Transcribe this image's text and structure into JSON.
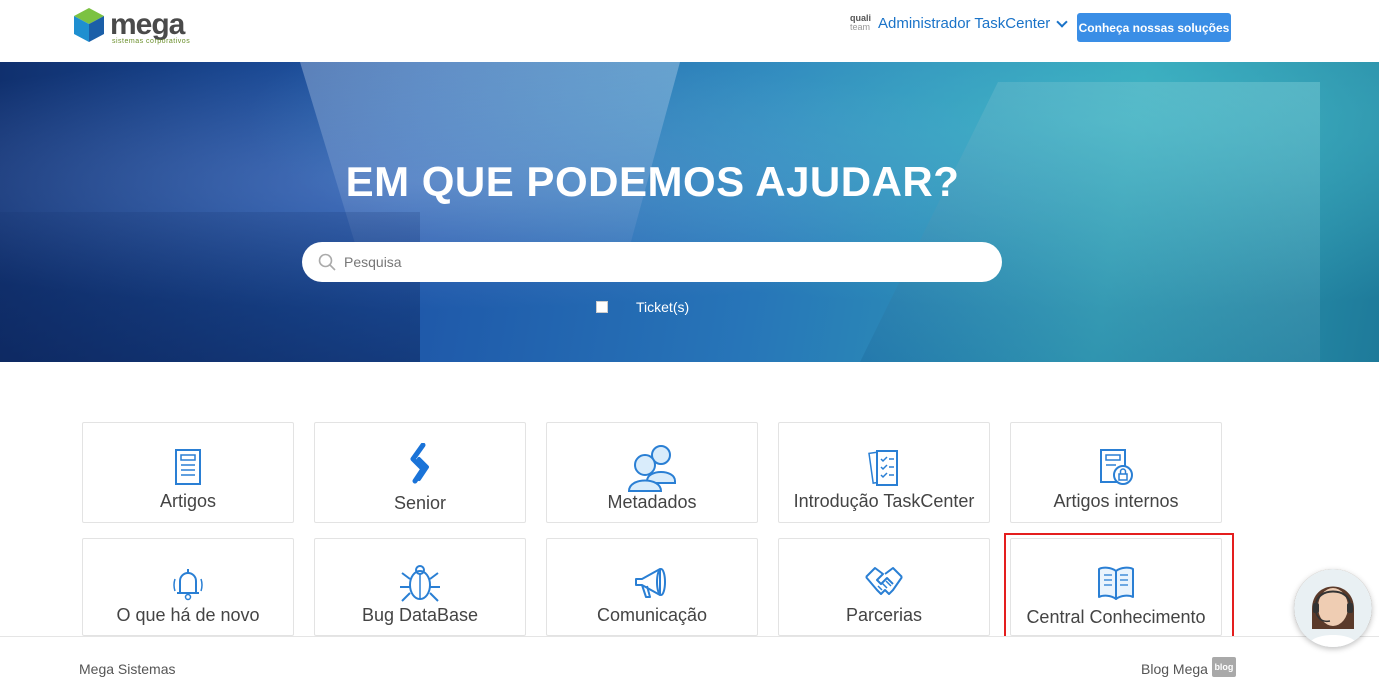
{
  "header": {
    "brand": "mega",
    "brand_sub": "sistemas corporativos",
    "partner_top": "quali",
    "partner_bottom": "team",
    "user_label": "Administrador TaskCenter",
    "cta_label": "Conheça nossas soluções"
  },
  "hero": {
    "title": "EM QUE PODEMOS AJUDAR?",
    "search_placeholder": "Pesquisa",
    "ticket_label": "Ticket(s)",
    "ticket_checked": false
  },
  "tiles": [
    {
      "label": "Artigos",
      "icon": "document-icon"
    },
    {
      "label": "Senior",
      "icon": "senior-logo-icon"
    },
    {
      "label": "Metadados",
      "icon": "users-icon"
    },
    {
      "label": "Introdução TaskCenter",
      "icon": "checklist-icon"
    },
    {
      "label": "Artigos internos",
      "icon": "locked-document-icon"
    },
    {
      "label": "O que há de novo",
      "icon": "bell-icon"
    },
    {
      "label": "Bug DataBase",
      "icon": "bug-icon"
    },
    {
      "label": "Comunicação",
      "icon": "megaphone-icon"
    },
    {
      "label": "Parcerias",
      "icon": "handshake-icon"
    },
    {
      "label": "Central Conhecimento",
      "icon": "book-icon"
    }
  ],
  "footer": {
    "left": "Mega Sistemas",
    "right": "Blog Mega",
    "badge": "blog"
  },
  "colors": {
    "accent": "#1a73c8",
    "cta": "#3a8ee6",
    "icon": "#2a7fd4",
    "highlight": "#e41e1e"
  }
}
